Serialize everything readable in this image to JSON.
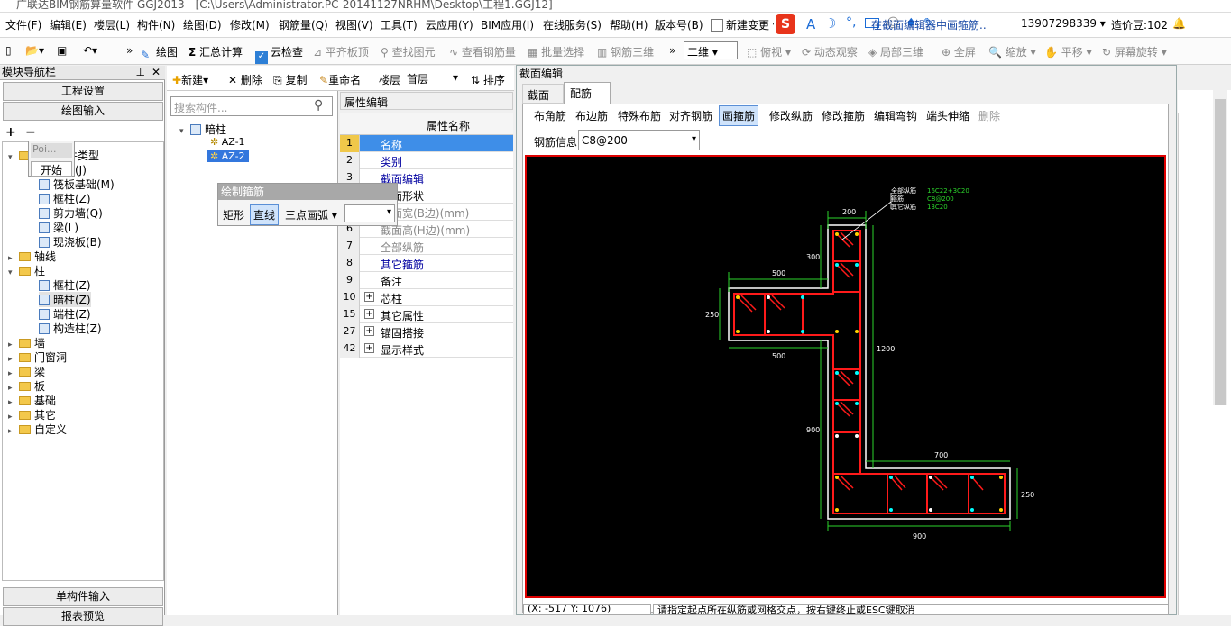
{
  "window": {
    "title": "广联达BIM钢筋算量软件 GGJ2013 - [C:\\Users\\Administrator.PC-20141127NRHM\\Desktop\\工程1.GGJ12]"
  },
  "menu": [
    "文件(F)",
    "编辑(E)",
    "楼层(L)",
    "构件(N)",
    "绘图(D)",
    "修改(M)",
    "钢筋量(Q)",
    "视图(V)",
    "工具(T)",
    "云应用(Y)",
    "BIM应用(I)",
    "在线服务(S)",
    "帮助(H)",
    "版本号(B)",
    "新建变更"
  ],
  "status_area": {
    "hint": "在截面编辑器中画箍筋..",
    "phone": "13907298339",
    "price": "造价豆:102"
  },
  "toolbar": {
    "items": [
      "绘图",
      "汇总计算",
      "云检查",
      "平齐板顶",
      "查找图元",
      "查看钢筋量",
      "批量选择",
      "钢筋三维",
      "二维",
      "俯视",
      "动态观察",
      "局部三维",
      "全屏",
      "缩放",
      "平移",
      "屏幕旋转"
    ]
  },
  "nav": {
    "header": "模块导航栏",
    "btn_project": "工程设置",
    "btn_draw": "绘图输入",
    "btn_single": "单构件输入",
    "btn_report": "报表预览",
    "tree": [
      "常用构件类型",
      "轴网(J)",
      "筏板基础(M)",
      "框柱(Z)",
      "剪力墙(Q)",
      "梁(L)",
      "现浇板(B)",
      "轴线",
      "柱",
      "框柱(Z)",
      "暗柱(Z)",
      "端柱(Z)",
      "构造柱(Z)",
      "墙",
      "门窗洞",
      "梁",
      "板",
      "基础",
      "其它",
      "自定义"
    ]
  },
  "popup": {
    "tab": "Poi...",
    "start": "开始"
  },
  "complist": {
    "toolbar": [
      "新建",
      "删除",
      "复制",
      "重命名",
      "楼层",
      "首层",
      "排序"
    ],
    "search_placeholder": "搜索构件...",
    "root": "暗柱",
    "items": [
      "AZ-1",
      "AZ-2"
    ]
  },
  "stirrup_panel": {
    "title": "绘制箍筋",
    "options": [
      "矩形",
      "直线",
      "三点画弧"
    ]
  },
  "props": {
    "tab": "属性编辑",
    "header": "属性名称",
    "rows": [
      {
        "n": "1",
        "label": "名称"
      },
      {
        "n": "2",
        "label": "类别"
      },
      {
        "n": "3",
        "label": "截面编辑"
      },
      {
        "n": "4",
        "label": "截面形状"
      },
      {
        "n": "5",
        "label": "截面宽(B边)(mm)"
      },
      {
        "n": "6",
        "label": "截面高(H边)(mm)"
      },
      {
        "n": "7",
        "label": "全部纵筋"
      },
      {
        "n": "8",
        "label": "其它箍筋"
      },
      {
        "n": "9",
        "label": "备注"
      },
      {
        "n": "10",
        "label": "芯柱"
      },
      {
        "n": "15",
        "label": "其它属性"
      },
      {
        "n": "27",
        "label": "锚固搭接"
      },
      {
        "n": "42",
        "label": "显示样式"
      }
    ]
  },
  "editor": {
    "title": "截面编辑",
    "tabs": [
      "截面",
      "配筋"
    ],
    "tools": [
      "布角筋",
      "布边筋",
      "特殊布筋",
      "对齐钢筋",
      "画箍筋",
      "修改纵筋",
      "修改箍筋",
      "编辑弯钩",
      "端头伸缩",
      "删除"
    ],
    "rebar_label": "钢筋信息",
    "rebar_value": "C8@200",
    "status_coord": "(X: -517 Y: 1076)",
    "status_msg": "请指定起点所在纵筋或网格交点，按右键终止或ESC键取消"
  },
  "drawing": {
    "legend": [
      {
        "k": "全部纵筋",
        "v": "16C22+3C20"
      },
      {
        "k": "箍筋",
        "v": "C8@200"
      },
      {
        "k": "其它纵筋",
        "v": "13C20"
      }
    ],
    "dims": [
      "200",
      "300",
      "500",
      "250",
      "500",
      "1200",
      "900",
      "700",
      "250",
      "900"
    ]
  }
}
